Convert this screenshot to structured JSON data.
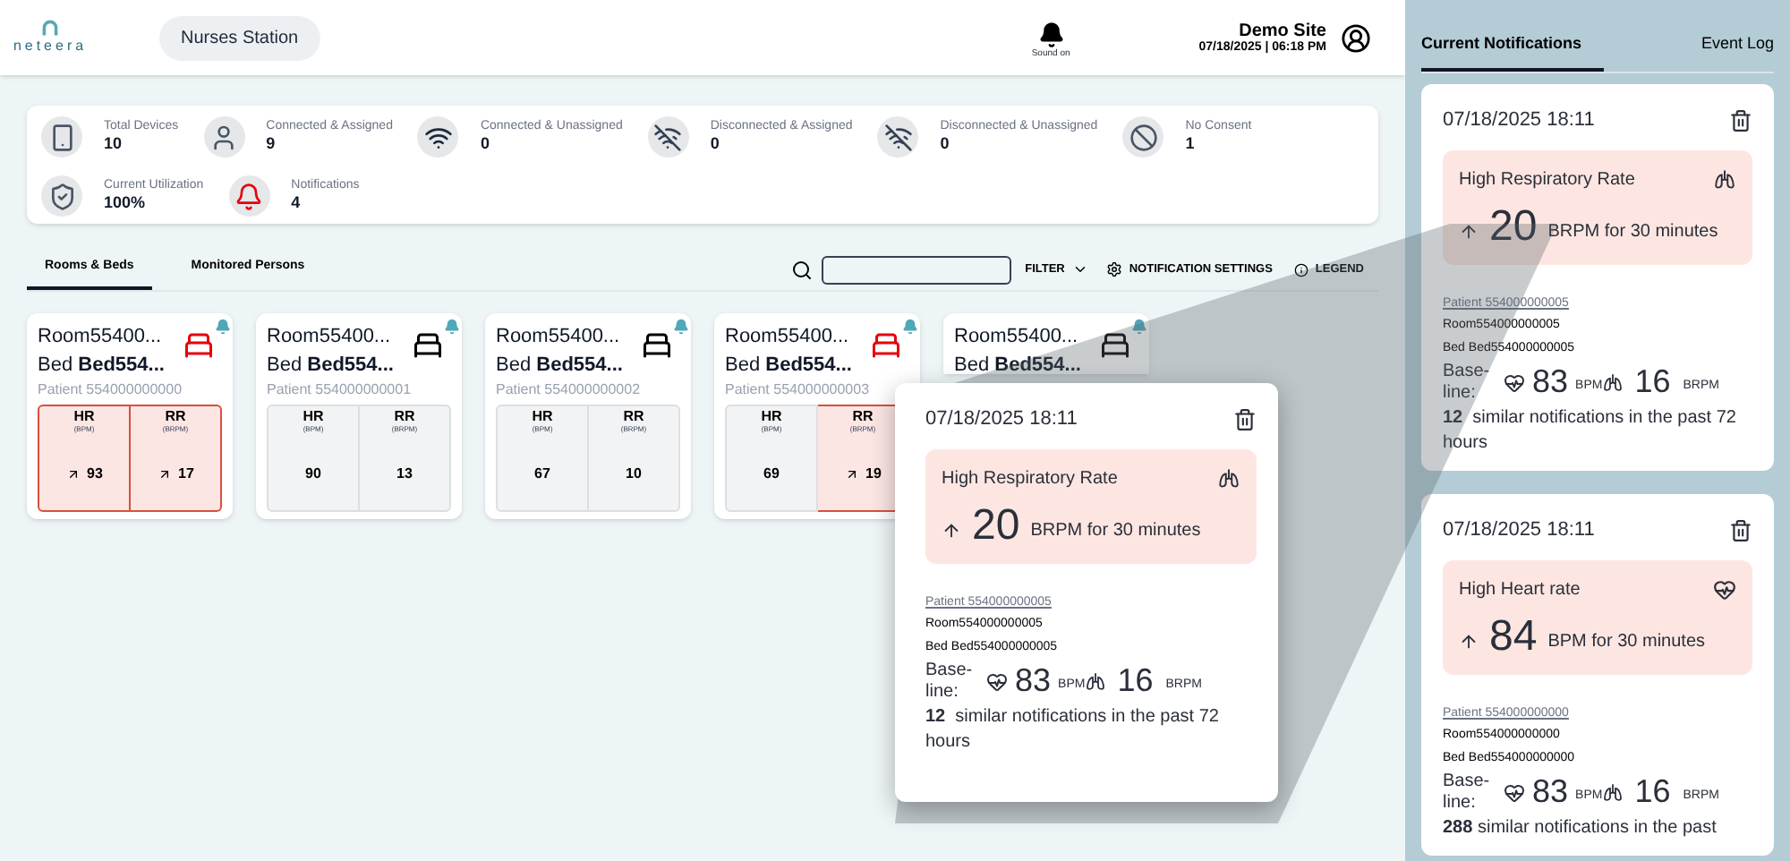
{
  "header": {
    "logo": "neteera",
    "station": "Nurses Station",
    "sound": "Sound on",
    "site": "Demo Site",
    "datetime": "07/18/2025 | 06:18 PM"
  },
  "stats": [
    {
      "kind": "devices",
      "label": "Total Devices",
      "value": "10"
    },
    {
      "kind": "person",
      "label": "Connected & Assigned",
      "value": "9"
    },
    {
      "kind": "wifi",
      "label": "Connected & Unassigned",
      "value": "0"
    },
    {
      "kind": "wifi-off",
      "label": "Disconnected & Assigned",
      "value": "0"
    },
    {
      "kind": "wifi-off",
      "label": "Disconnected & Unassigned",
      "value": "0"
    },
    {
      "kind": "ban",
      "label": "No Consent",
      "value": "1"
    },
    {
      "kind": "shield",
      "label": "Current Utilization",
      "value": "100%"
    },
    {
      "kind": "bell",
      "label": "Notifications",
      "value": "4"
    }
  ],
  "tabs": [
    {
      "label": "Rooms & Beds",
      "selected": true
    },
    {
      "label": "Monitored Persons",
      "selected": false
    }
  ],
  "toolbar": {
    "filter": "FILTER",
    "settings": "NOTIFICATION SETTINGS",
    "legend": "LEGEND"
  },
  "beds": [
    {
      "room": "Room55400...",
      "bed": "Bed **Bed554...**",
      "patient": "Patient 554000000000",
      "alert": true,
      "metrics": [
        {
          "name": "HR",
          "unit": "(BPM)",
          "value": "93",
          "alert": true
        },
        {
          "name": "RR",
          "unit": "(BRPM)",
          "value": "17",
          "alert": true
        }
      ]
    },
    {
      "room": "Room55400...",
      "bed": "Bed **Bed554...**",
      "patient": "Patient 554000000001",
      "alert": false,
      "metrics": [
        {
          "name": "HR",
          "unit": "(BPM)",
          "value": "90",
          "alert": false
        },
        {
          "name": "RR",
          "unit": "(BRPM)",
          "value": "13",
          "alert": false
        }
      ]
    },
    {
      "room": "Room55400...",
      "bed": "Bed **Bed554...**",
      "patient": "Patient 554000000002",
      "alert": false,
      "metrics": [
        {
          "name": "HR",
          "unit": "(BPM)",
          "value": "67",
          "alert": false
        },
        {
          "name": "RR",
          "unit": "(BRPM)",
          "value": "10",
          "alert": false
        }
      ]
    },
    {
      "room": "Room55400...",
      "bed": "Bed **Bed554...**",
      "patient": "Patient 554000000003",
      "alert": true,
      "metrics": [
        {
          "name": "HR",
          "unit": "(BPM)",
          "value": "69",
          "alert": false
        },
        {
          "name": "RR",
          "unit": "(BRPM)",
          "value": "19",
          "alert": true
        }
      ]
    },
    {
      "room": "Room55400...",
      "bed": "Bed **Bed554...**",
      "alert": false
    }
  ],
  "popup": {
    "date": "07/18/2025 18:11",
    "title": "High Respiratory Rate",
    "kind": "rr",
    "value": "20",
    "unit_text": "BRPM for 30 minutes",
    "patient": "Patient 554000000005",
    "room": "Room554000000005",
    "bed": "Bed Bed554000000005",
    "baseline_label": "Base-line:",
    "hr_value": "83",
    "hr_unit": "BPM",
    "rr_value": "16",
    "rr_unit": "BRPM",
    "similar": "**12**  similar notifications in the past 72 hours"
  },
  "panel": {
    "tabs": [
      {
        "label": "Current Notifications",
        "selected": true
      },
      {
        "label": "Event Log",
        "selected": false
      }
    ],
    "notifications": [
      {
        "date": "07/18/2025 18:11",
        "title": "High Respiratory Rate",
        "kind": "rr",
        "value": "20",
        "unit_text": "BRPM for 30 minutes",
        "patient": "Patient 554000000005",
        "room": "Room554000000005",
        "bed": "Bed Bed554000000005",
        "baseline_label": "Base-line:",
        "hr_value": "83",
        "hr_unit": "BPM",
        "rr_value": "16",
        "rr_unit": "BRPM",
        "similar": "**12**  similar notifications in the past 72 hours"
      },
      {
        "date": "07/18/2025 18:11",
        "title": "High Heart rate",
        "kind": "hr",
        "value": "84",
        "unit_text": "BPM for 30 minutes",
        "patient": "Patient 554000000000",
        "room": "Room554000000000",
        "bed": "Bed Bed554000000000",
        "baseline_label": "Base-line:",
        "hr_value": "83",
        "hr_unit": "BPM",
        "rr_value": "16",
        "rr_unit": "BRPM",
        "similar": "**288** similar notifications in the past"
      }
    ]
  }
}
